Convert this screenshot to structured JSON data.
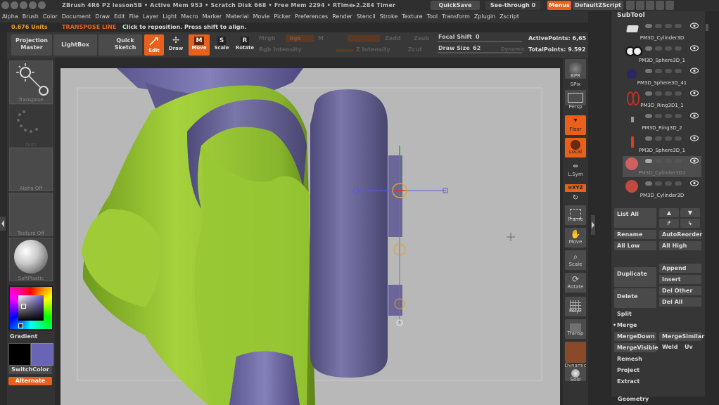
{
  "titlebar": {
    "text": "ZBrush 4R6 P2    lesson5B    • Active Mem 953 • Scratch Disk 668 • Free Mem 2294 • RTime▸2.284 Timer",
    "quicksave": "QuickSave",
    "see_through": "See-through  0",
    "menus": "Menus",
    "script": "DefaultZScript"
  },
  "menu": [
    "Alpha",
    "Brush",
    "Color",
    "Document",
    "Draw",
    "Edit",
    "File",
    "Layer",
    "Light",
    "Macro",
    "Marker",
    "Material",
    "Movie",
    "Picker",
    "Preferences",
    "Render",
    "Stencil",
    "Stroke",
    "Texture",
    "Tool",
    "Transform",
    "Zplugin",
    "Zscript"
  ],
  "info": {
    "units": "0.676 Units",
    "mode": "TRANSPOSE LINE",
    "hint": "Click to reposition. Press shift to align."
  },
  "toolbar": {
    "projection": "Projection\nMaster",
    "lightbox": "LightBox",
    "quick_sketch": "Quick\nSketch",
    "edit": "Edit",
    "draw": "Draw",
    "move": "Move",
    "scale": "Scale",
    "rotate": "Rotate",
    "mrgb": "Mrgb",
    "rgb_label": "Rgb",
    "m_label": "M",
    "zadd": "Zadd",
    "zsub": "Zsub",
    "zcut": "Zcut",
    "rgb_intensity": "Rgb Intensity",
    "z_intensity": "Z Intensity",
    "focal_shift_label": "Focal Shift",
    "focal_shift_value": "0",
    "draw_size_label": "Draw Size",
    "draw_size_value": "62",
    "dynamic": "Dynamic",
    "active_points": "ActivePoints: 6,65",
    "total_points": "TotalPoints: 9.592"
  },
  "left": {
    "transpose": "Transpose",
    "dots": "Dots",
    "alpha": "Alpha Off",
    "texture": "Texture Off",
    "material": "SoftPlastic",
    "gradient": "Gradient",
    "switchcolor": "SwitchColor",
    "alternate": "Alternate"
  },
  "right_shelf": {
    "bpr": "BPR",
    "spix": "SPix",
    "persp": "Persp",
    "floor": "Floor",
    "local": "Local",
    "lsym": "L.Sym",
    "xyz": "⊕XYZ",
    "frame": "Frame",
    "move": "Move",
    "scale": "Scale",
    "rotate": "Rotate",
    "polyf": "PolyF",
    "transp": "Transp",
    "dynamic": "Dynamic",
    "solo": "Solo"
  },
  "subtool": {
    "title": "SubTool",
    "items": [
      {
        "name": "PM3D_Cylinder3D"
      },
      {
        "name": "PM3D_Sphere3D_1"
      },
      {
        "name": "PM3D_Sphere3D_41"
      },
      {
        "name": "PM3D_Ring3D1_1"
      },
      {
        "name": "PM3D_Ring3D_2"
      },
      {
        "name": "PM3D_Sphere3D_1"
      },
      {
        "name": "PM3D_Cylinder3D1"
      },
      {
        "name": "PM3D_Cylinder3D"
      }
    ],
    "list_all": "List All",
    "rename": "Rename",
    "autoreorder": "AutoReorder",
    "all_low": "All Low",
    "all_high": "All High",
    "duplicate": "Duplicate",
    "append": "Append",
    "insert": "Insert",
    "delete": "Delete",
    "del_other": "Del Other",
    "del_all": "Del All",
    "split": "Split",
    "merge": "Merge",
    "mergedown": "MergeDown",
    "mergesimilar": "MergeSimilar",
    "mergevisible": "MergeVisible",
    "weld": "Weld",
    "uv": "Uv",
    "remesh": "Remesh",
    "project": "Project",
    "extract": "Extract",
    "geometry": "Geometry"
  },
  "colors": {
    "accent": "#e8601a",
    "body_green": "#96c832",
    "purple": "#6e6a9e",
    "canvas_bg": "#b8b8b8"
  }
}
